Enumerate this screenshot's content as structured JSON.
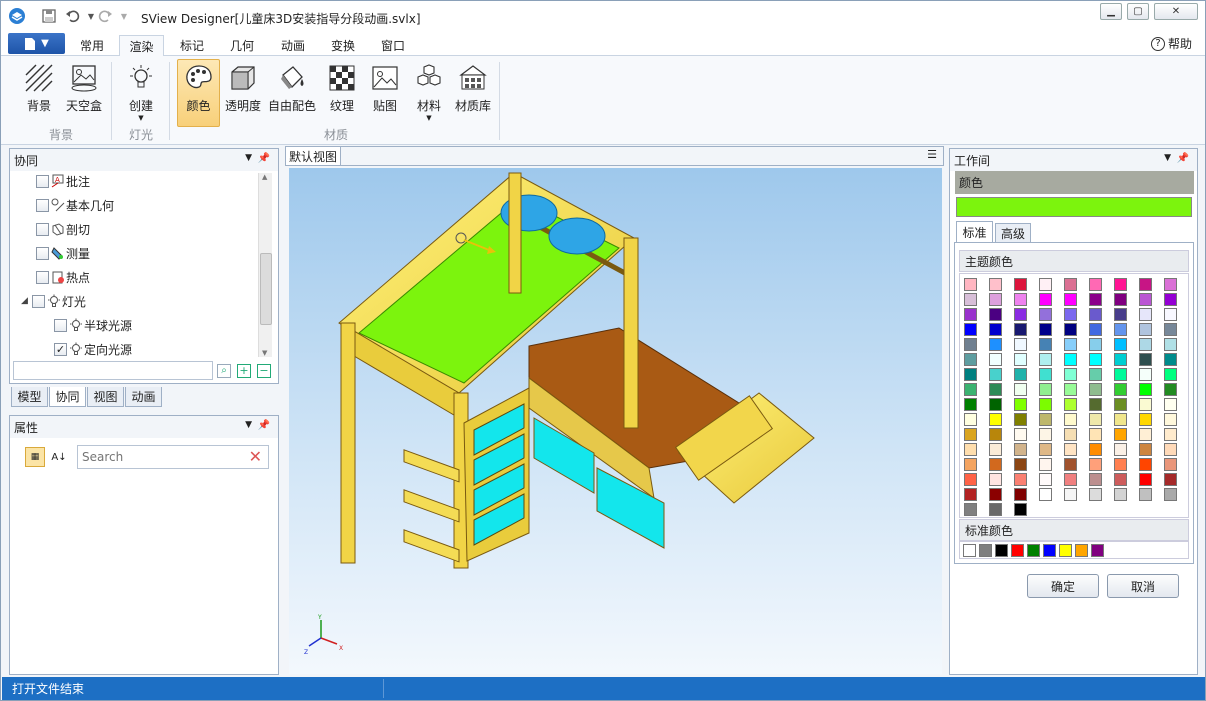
{
  "window": {
    "title": "SView Designer[儿童床3D安装指导分段动画.svlx]"
  },
  "menu": {
    "tabs": [
      "常用",
      "渲染",
      "标记",
      "几何",
      "动画",
      "变换",
      "窗口"
    ],
    "active_tab": "渲染",
    "help": "帮助"
  },
  "ribbon": {
    "buttons": [
      "背景",
      "天空盒",
      "创建",
      "颜色",
      "透明度",
      "自由配色",
      "纹理",
      "贴图",
      "材料",
      "材质库"
    ],
    "groups": [
      "背景",
      "灯光",
      "材质"
    ]
  },
  "collab_panel": {
    "title": "协同",
    "items": [
      "批注",
      "基本几何",
      "剖切",
      "测量",
      "热点",
      "灯光",
      "半球光源",
      "定向光源"
    ],
    "checked": [
      false,
      false,
      false,
      false,
      false,
      false,
      false,
      true
    ]
  },
  "left_tabs": [
    "模型",
    "协同",
    "视图",
    "动画"
  ],
  "props_panel": {
    "title": "属性",
    "search_placeholder": "Search"
  },
  "view": {
    "tab": "默认视图",
    "axes": {
      "x": "X",
      "y": "Y",
      "z": "Z"
    }
  },
  "workspace": {
    "title": "工作间",
    "color_label": "颜色",
    "current_color": "#7cf40d",
    "tabs": [
      "标准",
      "高级"
    ],
    "theme_colors_label": "主题颜色",
    "standard_colors_label": "标准颜色",
    "theme_colors": [
      [
        "#ffb6c1",
        "#ffc0cb",
        "#dc143c",
        "#fff0f5",
        "#db7093",
        "#ff69b4",
        "#ff1493",
        "#c71585",
        "#da70d6"
      ],
      [
        "#d8bfd8",
        "#dda0dd",
        "#ee82ee",
        "#ff00ff",
        "#ff00ff",
        "#8b008b",
        "#800080",
        "#ba55d3",
        "#9400d3"
      ],
      [
        "#9932cc",
        "#4b0082",
        "#8a2be2",
        "#9370db",
        "#7b68ee",
        "#6a5acd",
        "#483d8b",
        "#e6e6fa",
        "#f8f8ff"
      ],
      [
        "#0000ff",
        "#0000cd",
        "#191970",
        "#00008b",
        "#000080",
        "#4169e1",
        "#6495ed",
        "#b0c4de",
        "#778899"
      ],
      [
        "#708090",
        "#1e90ff",
        "#f0f8ff",
        "#4682b4",
        "#87cefa",
        "#87ceeb",
        "#00bfff",
        "#add8e6",
        "#b0e0e6"
      ],
      [
        "#5f9ea0",
        "#f0ffff",
        "#e0ffff",
        "#afeeee",
        "#00ffff",
        "#00ffff",
        "#00ced1",
        "#2f4f4f",
        "#008b8b"
      ],
      [
        "#008080",
        "#48d1cc",
        "#20b2aa",
        "#40e0d0",
        "#7fffd4",
        "#66cdaa",
        "#00fa9a",
        "#f5fffa",
        "#00ff7f"
      ],
      [
        "#3cb371",
        "#2e8b57",
        "#f0fff0",
        "#90ee90",
        "#98fb98",
        "#8fbc8f",
        "#32cd32",
        "#00ff00",
        "#228b22"
      ],
      [
        "#008000",
        "#006400",
        "#7fff00",
        "#7cfc00",
        "#adff2f",
        "#556b2f",
        "#6b8e23",
        "#fafad2",
        "#fffff0"
      ],
      [
        "#ffffe0",
        "#ffff00",
        "#808000",
        "#bdb76b",
        "#fffacd",
        "#eee8aa",
        "#f0e68c",
        "#ffd700",
        "#fff8dc"
      ],
      [
        "#daa520",
        "#b8860b",
        "#fffaf0",
        "#fdf5e6",
        "#f5deb3",
        "#ffe4b5",
        "#ffa500",
        "#ffefd5",
        "#ffebcd"
      ],
      [
        "#ffdead",
        "#faebd7",
        "#d2b48c",
        "#deb887",
        "#ffe4c4",
        "#ff8c00",
        "#faf0e6",
        "#cd853f",
        "#ffdab9"
      ],
      [
        "#f4a460",
        "#d2691e",
        "#8b4513",
        "#fff5ee",
        "#a0522d",
        "#ffa07a",
        "#ff7f50",
        "#ff4500",
        "#e9967a"
      ],
      [
        "#ff6347",
        "#ffe4e1",
        "#fa8072",
        "#fffafa",
        "#f08080",
        "#bc8f8f",
        "#cd5c5c",
        "#ff0000",
        "#a52a2a"
      ],
      [
        "#b22222",
        "#8b0000",
        "#800000",
        "#ffffff",
        "#f5f5f5",
        "#dcdcdc",
        "#d3d3d3",
        "#c0c0c0",
        "#a9a9a9"
      ],
      [
        "#808080",
        "#696969",
        "#000000"
      ]
    ],
    "standard_colors": [
      "#ffffff",
      "#7f7f7f",
      "#000000",
      "#ff0000",
      "#008000",
      "#0000ff",
      "#ffff00",
      "#ffa500",
      "#800080"
    ],
    "ok": "确定",
    "cancel": "取消"
  },
  "status": {
    "text": "打开文件结束"
  }
}
